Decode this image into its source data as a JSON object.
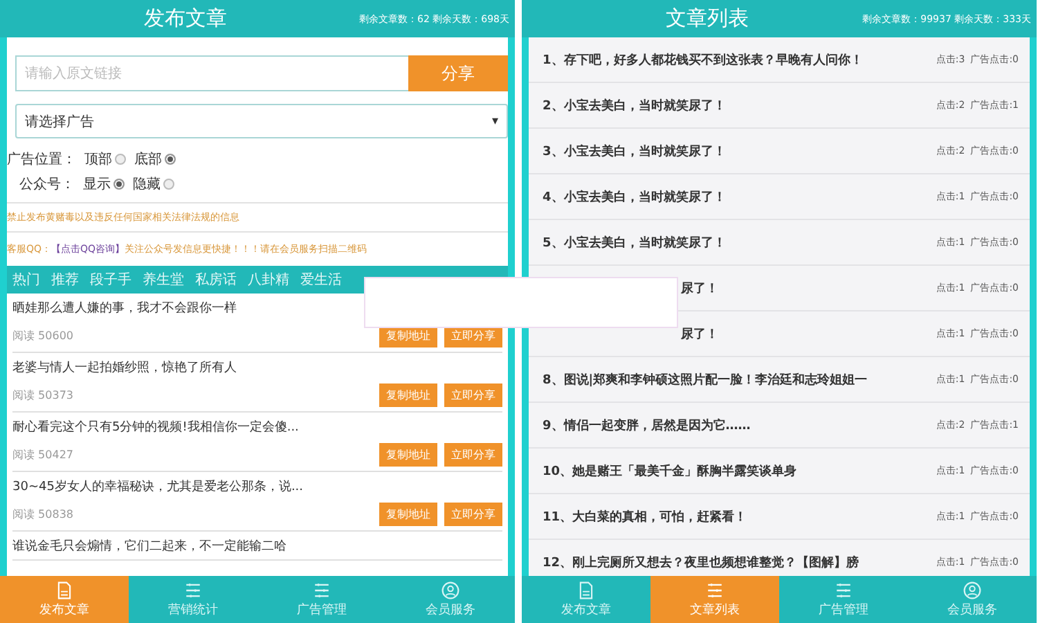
{
  "screens": [
    {
      "kind": "publish",
      "title": "发布文章",
      "stats": "剩余文章数：62 剩余天数：698天",
      "url_field": {
        "placeholder": "请输入原文链接"
      },
      "share_button": "分享",
      "ad_select": {
        "value": "请选择广告",
        "caret": "▾"
      },
      "radio_groups": [
        {
          "label": "广告位置：",
          "options": [
            {
              "label": "顶部",
              "selected": false
            },
            {
              "label": "底部",
              "selected": true
            }
          ]
        },
        {
          "label": "公众号：",
          "options": [
            {
              "label": "显示",
              "selected": true
            },
            {
              "label": "隐藏",
              "selected": false
            }
          ]
        }
      ],
      "warning": "禁止发布黄赌毒以及违反任何国家相关法律法规的信息",
      "contact": {
        "before": "客服QQ：",
        "link": "【点击QQ咨询】",
        "after": "关注公众号发信息更快捷！！！请在会员服务扫描二维码"
      },
      "categories": [
        {
          "label": "热门",
          "selected": false
        },
        {
          "label": "推荐",
          "selected": false
        },
        {
          "label": "段子手",
          "selected": false
        },
        {
          "label": "养生堂",
          "selected": false
        },
        {
          "label": "私房话",
          "selected": false
        },
        {
          "label": "八卦精",
          "selected": false
        },
        {
          "label": "爱生活",
          "selected": false
        }
      ],
      "articles": [
        {
          "title": "晒娃那么遭人嫌的事，我才不会跟你一样",
          "reads": "阅读 50600",
          "copy": "复制地址",
          "share": "立即分享"
        },
        {
          "title": "老婆与情人一起拍婚纱照，惊艳了所有人",
          "reads": "阅读 50373",
          "copy": "复制地址",
          "share": "立即分享"
        },
        {
          "title": "耐心看完这个只有5分钟的视频!我相信你一定会傻...",
          "reads": "阅读 50427",
          "copy": "复制地址",
          "share": "立即分享"
        },
        {
          "title": "30~45岁女人的幸福秘诀，尤其是爱老公那条，说...",
          "reads": "阅读 50838",
          "copy": "复制地址",
          "share": "立即分享"
        },
        {
          "title": "谁说金毛只会煽情，它们二起来，不一定能输二哈"
        }
      ],
      "nav": [
        {
          "label": "发布文章",
          "selected": true
        },
        {
          "label": "营销统计",
          "selected": false
        },
        {
          "label": "广告管理",
          "selected": false
        },
        {
          "label": "会员服务",
          "selected": false
        }
      ]
    },
    {
      "kind": "list",
      "title": "文章列表",
      "stats": "剩余文章数：99937 剩余天数：333天",
      "rows": [
        {
          "kind": "full",
          "title": "1、存下吧，好多人都花钱买不到这张表？早晚有人问你！",
          "clicks": "点击:3",
          "ad_clicks": "广告点击:0"
        },
        {
          "kind": "full",
          "title": "2、小宝去美白，当时就笑尿了！",
          "clicks": "点击:2",
          "ad_clicks": "广告点击:1"
        },
        {
          "kind": "full",
          "title": "3、小宝去美白，当时就笑尿了！",
          "clicks": "点击:2",
          "ad_clicks": "广告点击:0"
        },
        {
          "kind": "full",
          "title": "4、小宝去美白，当时就笑尿了！",
          "clicks": "点击:1",
          "ad_clicks": "广告点击:0"
        },
        {
          "kind": "full",
          "title": "5、小宝去美白，当时就笑尿了！",
          "clicks": "点击:1",
          "ad_clicks": "广告点击:0"
        },
        {
          "kind": "covered",
          "title": "尿了！",
          "clicks": "点击:1",
          "ad_clicks": "广告点击:0"
        },
        {
          "kind": "covered",
          "title": "尿了！",
          "clicks": "点击:1",
          "ad_clicks": "广告点击:0"
        },
        {
          "kind": "full",
          "title": "8、图说|郑爽和李钟硕这照片配一脸！李治廷和志玲姐姐一",
          "clicks": "点击:1",
          "ad_clicks": "广告点击:0"
        },
        {
          "kind": "full",
          "title": "9、情侣一起变胖，居然是因为它……",
          "clicks": "点击:2",
          "ad_clicks": "广告点击:1"
        },
        {
          "kind": "full",
          "title": "10、她是赌王「最美千金」酥胸半露笑谈单身",
          "clicks": "点击:1",
          "ad_clicks": "广告点击:0"
        },
        {
          "kind": "full",
          "title": "11、大白菜的真相，可怕，赶紧看！",
          "clicks": "点击:1",
          "ad_clicks": "广告点击:0"
        },
        {
          "kind": "full",
          "title": "12、刚上完厕所又想去？夜里也频想谁整觉？【图解】膀",
          "clicks": "点击:1",
          "ad_clicks": "广告点击:0"
        }
      ],
      "nav": [
        {
          "label": "发布文章",
          "selected": false
        },
        {
          "label": "文章列表",
          "selected": true
        },
        {
          "label": "广告管理",
          "selected": false
        },
        {
          "label": "会员服务",
          "selected": false
        }
      ]
    }
  ]
}
